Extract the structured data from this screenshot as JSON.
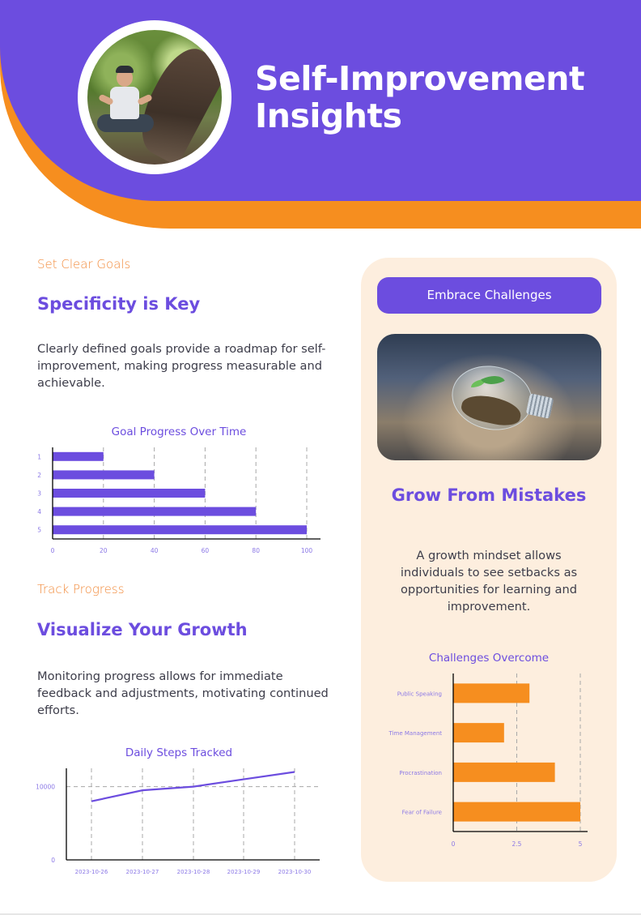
{
  "header": {
    "title_line1": "Self-Improvement",
    "title_line2": "Insights",
    "avatar_alt": "Person meditating in a forest",
    "colors": {
      "primary": "#6c4ddf",
      "accent": "#f68e1f"
    }
  },
  "section1": {
    "eyebrow": "Set Clear Goals",
    "heading": "Specificity is Key",
    "body": "Clearly defined goals provide a roadmap for self-improvement, making progress measurable and achievable."
  },
  "section2": {
    "eyebrow": "Track Progress",
    "heading": "Visualize Your Growth",
    "body": "Monitoring progress allows for immediate feedback and adjustments, motivating continued efforts."
  },
  "panel": {
    "button_label": "Embrace Challenges",
    "image_alt": "Seedling growing inside a light bulb",
    "heading": "Grow From Mistakes",
    "body": "A growth mindset allows individuals to see setbacks as opportunities for learning and improvement.",
    "background": "#fdeede"
  },
  "chart_data": [
    {
      "type": "bar",
      "orientation": "horizontal",
      "title": "Goal Progress Over Time",
      "categories": [
        "1",
        "2",
        "3",
        "4",
        "5"
      ],
      "values": [
        20,
        40,
        60,
        80,
        100
      ],
      "xlabel": "",
      "ylabel": "",
      "xlim": [
        0,
        100
      ],
      "xticks": [
        0,
        20,
        40,
        60,
        80,
        100
      ],
      "grid": "vertical dashed",
      "color": "#6c4ddf"
    },
    {
      "type": "line",
      "title": "Daily Steps Tracked",
      "x": [
        "2023-10-26",
        "2023-10-27",
        "2023-10-28",
        "2023-10-29",
        "2023-10-30"
      ],
      "values": [
        8000,
        9500,
        10000,
        11000,
        12000
      ],
      "xlabel": "",
      "ylabel": "",
      "ylim": [
        0,
        12500
      ],
      "yticks": [
        0,
        10000
      ],
      "grid": "dashed",
      "color": "#6c4ddf"
    },
    {
      "type": "bar",
      "orientation": "horizontal",
      "title": "Challenges Overcome",
      "categories": [
        "Public Speaking",
        "Time Management",
        "Procrastination",
        "Fear of Failure"
      ],
      "values": [
        3,
        2,
        4,
        5
      ],
      "xlabel": "",
      "ylabel": "",
      "xlim": [
        0,
        5
      ],
      "xticks": [
        0,
        2.5,
        5
      ],
      "grid": "vertical dashed",
      "color": "#f68e1f"
    }
  ]
}
